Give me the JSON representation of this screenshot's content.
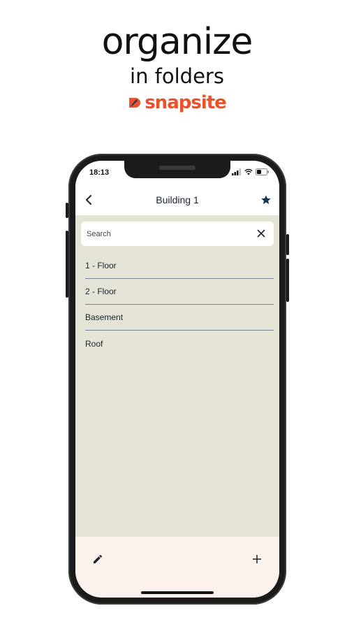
{
  "promo": {
    "title": "organize",
    "subtitle": "in folders",
    "brand_name": "snapsite",
    "brand_color": "#e8522c"
  },
  "status_bar": {
    "time": "18:13",
    "icons": [
      "cellular-signal-icon",
      "wifi-icon",
      "battery-icon"
    ]
  },
  "nav": {
    "back_icon": "chevron-left-icon",
    "title": "Building 1",
    "favorite_icon": "star-icon"
  },
  "search": {
    "placeholder": "Search",
    "value": "",
    "clear_icon": "close-icon"
  },
  "folders": [
    {
      "label": "1 - Floor"
    },
    {
      "label": "2 - Floor"
    },
    {
      "label": "Basement"
    },
    {
      "label": "Roof"
    }
  ],
  "bottom_bar": {
    "edit_icon": "pencil-icon",
    "add_icon": "plus-icon"
  },
  "colors": {
    "screen_background": "#e5e3d5",
    "bottom_bar_background": "#fbf2ee",
    "text_dark": "#1c2430",
    "divider": "#7a8590"
  }
}
